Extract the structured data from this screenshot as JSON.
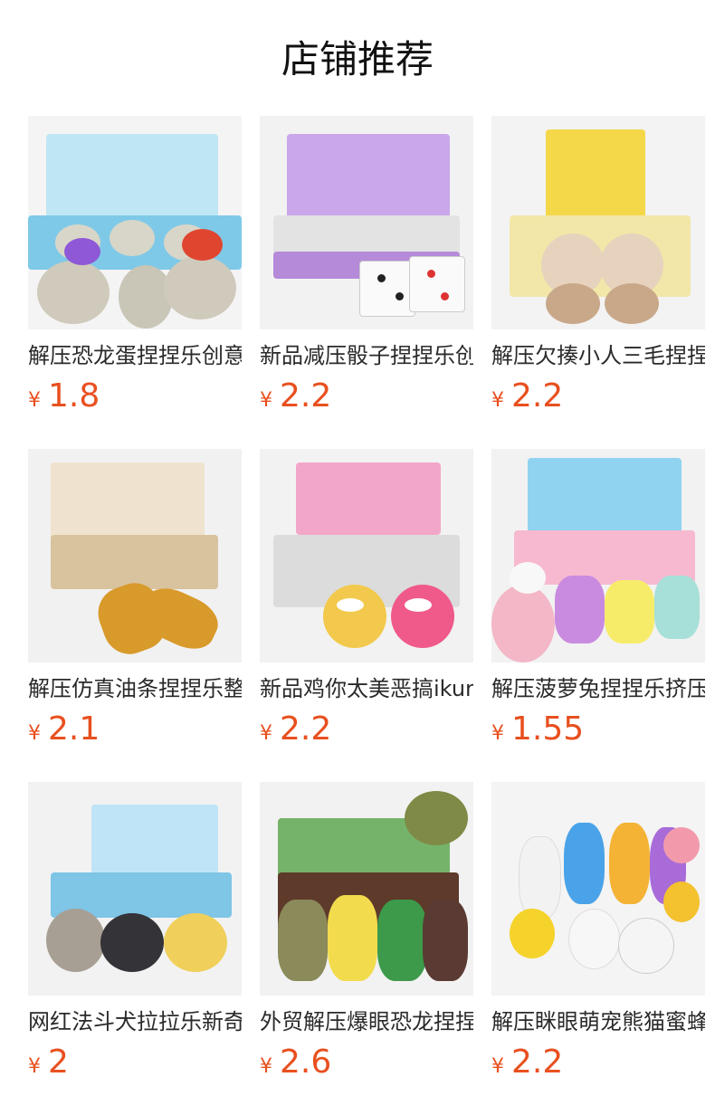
{
  "page_title": "店铺推荐",
  "currency": "¥",
  "colors": {
    "price": "#e8501f",
    "title": "#111111"
  },
  "products": [
    {
      "name": "解压恐龙蛋捏捏乐创意",
      "price": "1.8"
    },
    {
      "name": "新品减压骰子捏捏乐创",
      "price": "2.2"
    },
    {
      "name": "解压欠揍小人三毛捏捏",
      "price": "2.2"
    },
    {
      "name": "解压仿真油条捏捏乐整",
      "price": "2.1"
    },
    {
      "name": "新品鸡你太美恶搞ikun",
      "price": "2.2"
    },
    {
      "name": "解压菠萝兔捏捏乐挤压",
      "price": "1.55"
    },
    {
      "name": "网红法斗犬拉拉乐新奇",
      "price": "2"
    },
    {
      "name": "外贸解压爆眼恐龙捏捏",
      "price": "2.6"
    },
    {
      "name": "解压眯眼萌宠熊猫蜜蜂",
      "price": "2.2"
    }
  ]
}
